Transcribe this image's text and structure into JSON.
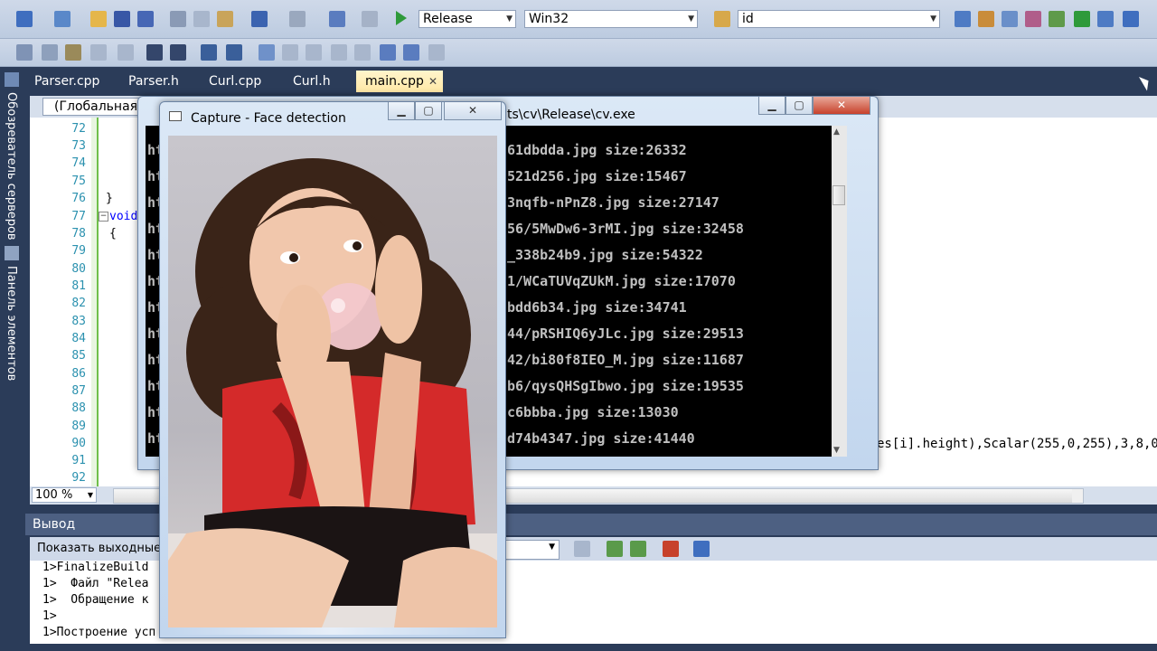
{
  "toolbar": {
    "config_value": "Release",
    "platform_value": "Win32",
    "find_value": "id"
  },
  "tabs": [
    {
      "label": "Parser.cpp"
    },
    {
      "label": "Parser.h"
    },
    {
      "label": "Curl.cpp"
    },
    {
      "label": "Curl.h"
    },
    {
      "label": "main.cpp"
    }
  ],
  "tab_close_glyph": "✕",
  "dock": {
    "servers": "Обозреватель серверов",
    "toolbox": "Панель элементов"
  },
  "editor": {
    "scope": "(Глобальная о",
    "line_numbers": [
      "72",
      "73",
      "74",
      "75",
      "76",
      "77",
      "78",
      "79",
      "80",
      "81",
      "82",
      "83",
      "84",
      "85",
      "86",
      "87",
      "88",
      "89",
      "90",
      "91",
      "92"
    ],
    "code_brace_close": "}",
    "code_void": "void",
    "code_brace_open": "{",
    "code_tail": "es[i].height),Scalar(255,0,255),3,8,0",
    "zoom": "100 %"
  },
  "capture_window": {
    "title": "Capture - Face detection"
  },
  "console_window": {
    "title": "ts\\cv\\Release\\cv.exe",
    "lines": [
      "61dbdda.jpg size:26332",
      "521d256.jpg size:15467",
      "3nqfb-nPnZ8.jpg size:27147",
      "56/5MwDw6-3rMI.jpg size:32458",
      "_338b24b9.jpg size:54322",
      "1/WCaTUVqZUkM.jpg size:17070",
      "bdd6b34.jpg size:34741",
      "44/pRSHIQ6yJLc.jpg size:29513",
      "42/bi80f8IEO_M.jpg size:11687",
      "b6/qysQHSgIbwo.jpg size:19535",
      "c6bbba.jpg size:13030",
      "d74b4347.jpg size:41440"
    ],
    "left_prefix": "ht"
  },
  "output": {
    "title": "Вывод",
    "show_label": "Показать выходные",
    "lines": [
      "1>FinalizeBuild",
      "1>  Файл \"Relea",
      "1>  Обращение к",
      "1>",
      "1>Построение усп"
    ]
  },
  "colors": {
    "chrome": "#2b3c59",
    "toolbar": "#cfd9e9",
    "active_tab": "#ffe8a6",
    "line_numbers": "#2b91af"
  }
}
